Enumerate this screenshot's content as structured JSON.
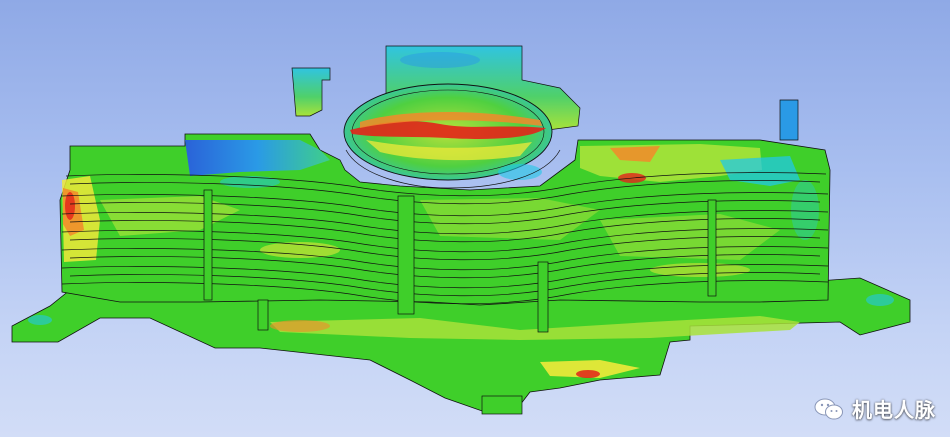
{
  "scene": {
    "background_top": "#8fa9e6",
    "background_bottom": "#d2ddf7",
    "contour_colors": {
      "green": "#3fcf2a",
      "lime": "#a8e23a",
      "yellow": "#f0e93a",
      "orange": "#f28a2a",
      "red": "#e2231a",
      "cyan": "#22c8e6",
      "blue": "#2a62d8"
    }
  },
  "watermark": {
    "icon": "wechat-icon",
    "text": "机电人脉"
  }
}
